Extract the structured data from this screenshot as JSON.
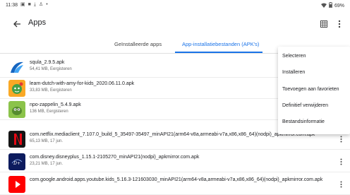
{
  "status_bar": {
    "time": "11:38",
    "battery": "69%"
  },
  "app_bar": {
    "title": "Apps"
  },
  "tabs": [
    {
      "label": "Geïnstalleerde apps",
      "selected": false
    },
    {
      "label": "App-installatiebestanden (APK's)",
      "selected": true
    }
  ],
  "colors": {
    "accent": "#1a73e8"
  },
  "files": [
    {
      "name": "squla_2.9.5.apk",
      "meta": "54,41 MB, Eergisteren",
      "icon": "squla-app-icon"
    },
    {
      "name": "learn-dutch-with-amy-for-kids_2020.06.11.0.apk",
      "meta": "33,83 MB, Eergisteren",
      "icon": "learn-dutch-amy-app-icon"
    },
    {
      "name": "npo-zappelin_5.4.9.apk",
      "meta": "136 MB, Eergisteren",
      "icon": "npo-zappelin-app-icon"
    },
    {
      "name": "com.netflix.mediaclient_7.107.0_build_5_35497-35497_minAPI21(arm64-v8a,armeabi-v7a,x86,x86_64)(nodpi)_apkmirror.com.apk",
      "meta": "65,13 MB, 17 jun.",
      "icon": "netflix-app-icon"
    },
    {
      "name": "com.disney.disneyplus_1.15.1-2105270_minAPI21(nodpi)_apkmirror.com.apk",
      "meta": "23,21 MB, 17 jun.",
      "icon": "disney-plus-app-icon"
    },
    {
      "name": "com.google.android.apps.youtube.kids_5.16.3-121603030_minAPI21(arm64-v8a,armeabi-v7a,x86,x86_64)(nodpi)_apkmirror.com.apk",
      "meta": "",
      "icon": "youtube-kids-app-icon"
    }
  ],
  "menu": {
    "items": [
      "Selecteren",
      "Installeren",
      "Toevoegen aan favorieten",
      "Definitief verwijderen",
      "Bestandsinformatie"
    ]
  }
}
